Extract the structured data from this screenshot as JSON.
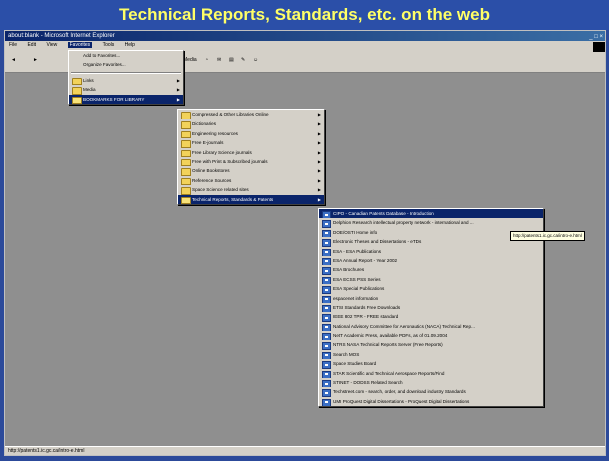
{
  "banner": {
    "title": "Technical Reports, Standards, etc. on the web"
  },
  "window": {
    "title": "about:blank - Microsoft Internet Explorer",
    "controls": "_ □ ×"
  },
  "menubar": [
    "File",
    "Edit",
    "View",
    "Favorites",
    "Tools",
    "Help"
  ],
  "toolbar": {
    "media": "Media"
  },
  "statusbar": {
    "text": "http://patents1.ic.gc.ca/intro-e.html"
  },
  "favorites_menu": {
    "items": [
      "Add to Favorites...",
      "Organize Favorites..."
    ],
    "folders": [
      "Links",
      "Media",
      "BOOKMARKS FOR LIBRARY"
    ]
  },
  "library_submenu": {
    "items": [
      "Compressed & Other Libraries Online",
      "Dictionaries",
      "Engineering resources",
      "Free E-journals",
      "Free Library Science journals",
      "Free with Print & Subscribed journals",
      "Online Bookstores",
      "Reference Sources",
      "Space Science related sites",
      "Technical Reports, Standards & Patents"
    ]
  },
  "reports_submenu": {
    "items": [
      "CIPO - Canadian Patents Database - Introduction",
      "Delphion Research intellectual property network - international and ...",
      "DOE/OSTI Home info",
      "Electronic Theses and Dissertations - eTDs",
      "ESA - ESA Publications",
      "ESA Annual Report - Year 2002",
      "ESA Brochures",
      "ESA ECSS PSS Series",
      "ESA Special Publications",
      "espacenet information",
      "ETSI Standards Free Downloads",
      "IEEE 802 TPR - FREE standard",
      "National Advisory Committee for Aeronautics (NACA) Technical Rep...",
      "NetT Academic Press, available PDFs, as of 01.09.2004",
      "NTRS NASA Technical Reports Server (Free Reports)",
      "Search MOS",
      "Space Studies Board",
      "STAR Scientific and Technical Aerospace Reports/Find",
      "STINET - DODSS Related Search",
      "Techstreet.com - search, order, and download industry Standards",
      "UMI ProQuest Digital Dissertations - ProQuest Digital Dissertations"
    ]
  },
  "tooltip": {
    "text": "http://patents1.ic.gc.ca/intro-e.html"
  }
}
